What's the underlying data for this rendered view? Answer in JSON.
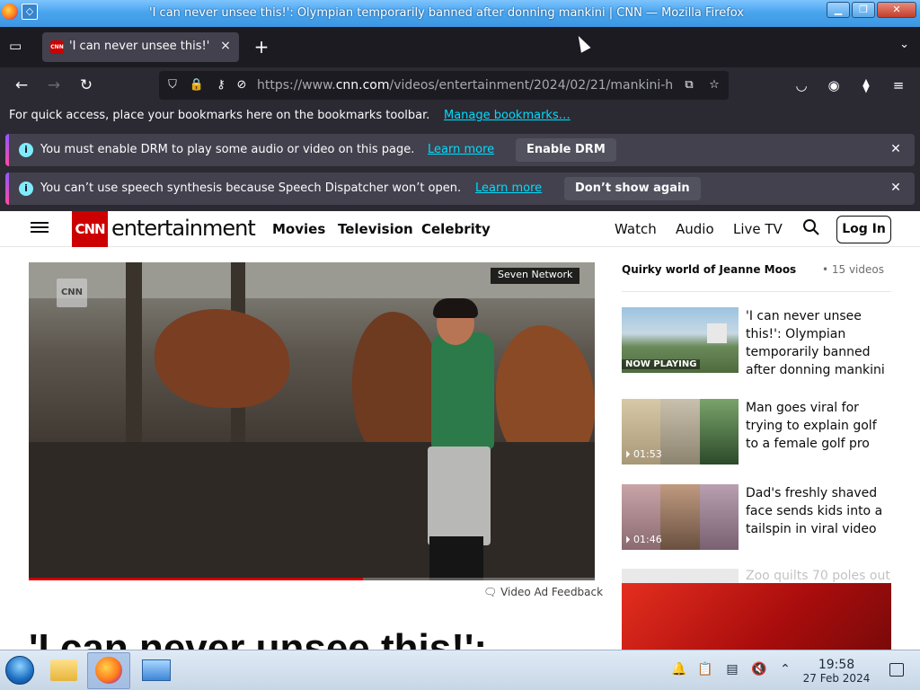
{
  "window": {
    "title": "'I can never unsee this!': Olympian temporarily banned after donning mankini | CNN — Mozilla Firefox"
  },
  "tabs": {
    "active_title": "'I can never unsee this!'",
    "close_label": "×",
    "new_tab_label": "+"
  },
  "navigation": {
    "url_prefix": "https://www.",
    "url_domain": "cnn.com",
    "url_path": "/videos/entertainment/2024/02/21/mankini-h"
  },
  "bookmarks": {
    "message": "For quick access, place your bookmarks here on the bookmarks toolbar.",
    "manage_link": "Manage bookmarks…"
  },
  "notifications": [
    {
      "message": "You must enable DRM to play some audio or video on this page.",
      "link": "Learn more",
      "button": "Enable DRM"
    },
    {
      "message": "You can’t use speech synthesis because Speech Dispatcher won’t open.",
      "link": "Learn more",
      "button": "Don’t show again"
    }
  ],
  "cnn": {
    "logo": "CNN",
    "section": "entertainment",
    "nav_left": [
      "Movies",
      "Television",
      "Celebrity"
    ],
    "nav_right": [
      "Watch",
      "Audio",
      "Live TV"
    ],
    "login": "Log In"
  },
  "video": {
    "watermark": "CNN",
    "network_label": "Seven Network",
    "progress": 0.59,
    "ad_feedback": "Video Ad Feedback"
  },
  "headline": "'I can never unsee this!':",
  "playlist": {
    "title": "Quirky world of Jeanne Moos",
    "count": "15 videos",
    "items": [
      {
        "tag": "NOW PLAYING",
        "caption": "'I can never unsee this!': Olympian temporarily banned after donning mankini"
      },
      {
        "duration": "01:53",
        "caption": "Man goes viral for trying to explain golf to a female golf pro"
      },
      {
        "duration": "01:46",
        "caption": "Dad's freshly shaved face sends kids into a tailspin in viral video"
      }
    ],
    "faded_caption": "Zoo quilts 70 poles out"
  },
  "taskbar": {
    "time": "19:58",
    "date": "27 Feb 2024"
  },
  "colors": {
    "cnn_red": "#cc0000",
    "firefox_link": "#00ddff",
    "titlebar_blue": "#4aa5ee"
  }
}
